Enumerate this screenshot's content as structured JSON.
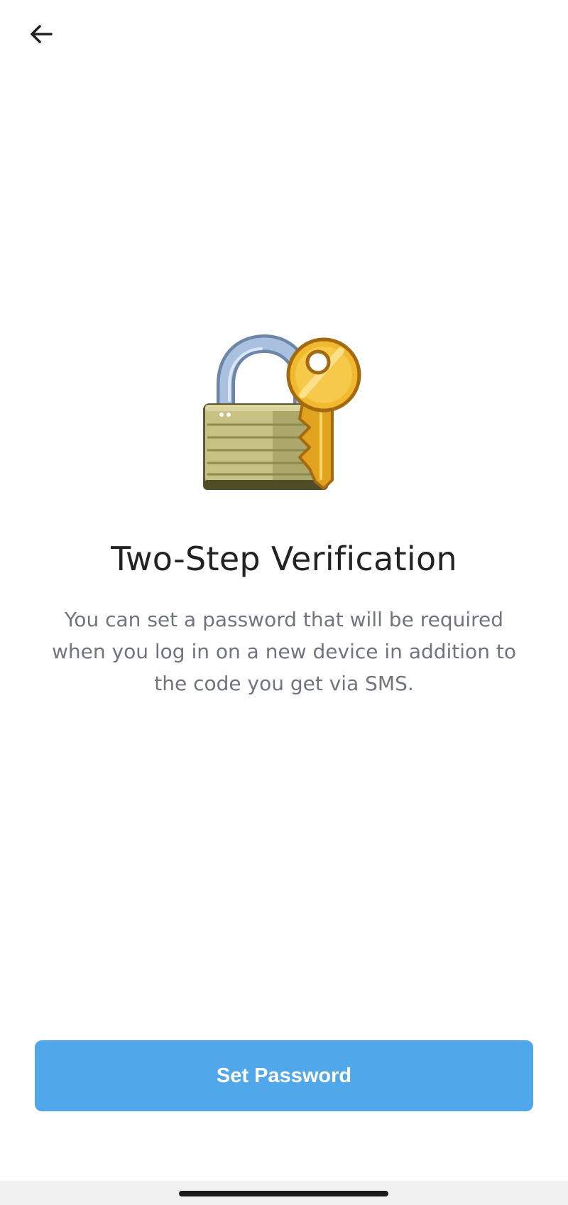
{
  "header": {
    "back_icon": "arrow-left-icon"
  },
  "hero": {
    "illustration": "lock-with-key-icon",
    "colors": {
      "lock_body": "#c2bd7e",
      "shackle": "#9eb6d8",
      "key": "#f2b82e"
    }
  },
  "content": {
    "title": "Two-Step Verification",
    "description": "You can set a password that will be required when you log in on a new device in addition to the code you get via SMS."
  },
  "actions": {
    "primary_label": "Set Password",
    "primary_color": "#50a7ea"
  }
}
